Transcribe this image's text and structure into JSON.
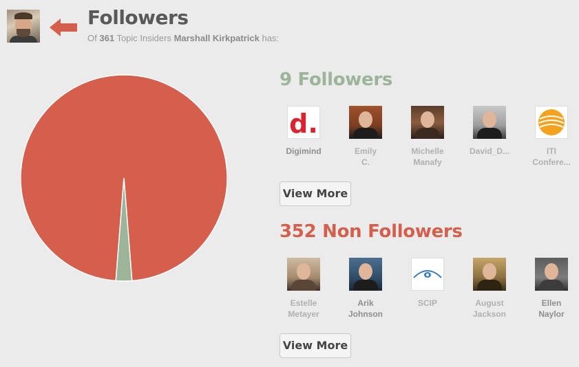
{
  "header": {
    "title": "Followers",
    "subtitle_prefix": "Of",
    "subtitle_count": "361",
    "subtitle_middle": "Topic Insiders",
    "subtitle_name": "Marshall Kirkpatrick",
    "subtitle_suffix": "has:"
  },
  "colors": {
    "followers": "#9cb59a",
    "non_followers": "#d45f4c"
  },
  "pie": {
    "followers": 9,
    "non_followers": 352
  },
  "followers": {
    "title": "9 Followers",
    "people": [
      {
        "name": "Digimind",
        "icon": "digimind-logo"
      },
      {
        "name": "Emily\nC.",
        "icon": "emily-avatar"
      },
      {
        "name": "Michelle\nManafy",
        "icon": "michelle-avatar"
      },
      {
        "name": "David_D...",
        "icon": "david-avatar"
      },
      {
        "name": "ITI\nConfere...",
        "icon": "iti-logo"
      }
    ],
    "view_more": "View More"
  },
  "non_followers": {
    "title": "352 Non Followers",
    "people": [
      {
        "name": "Estelle\nMetayer",
        "icon": "estelle-avatar"
      },
      {
        "name": "Arik\nJohnson",
        "icon": "arik-avatar"
      },
      {
        "name": "SCIP",
        "icon": "scip-logo"
      },
      {
        "name": "August\nJackson",
        "icon": "august-avatar"
      },
      {
        "name": "Ellen\nNaylor",
        "icon": "ellen-avatar"
      }
    ],
    "view_more": "View More"
  }
}
